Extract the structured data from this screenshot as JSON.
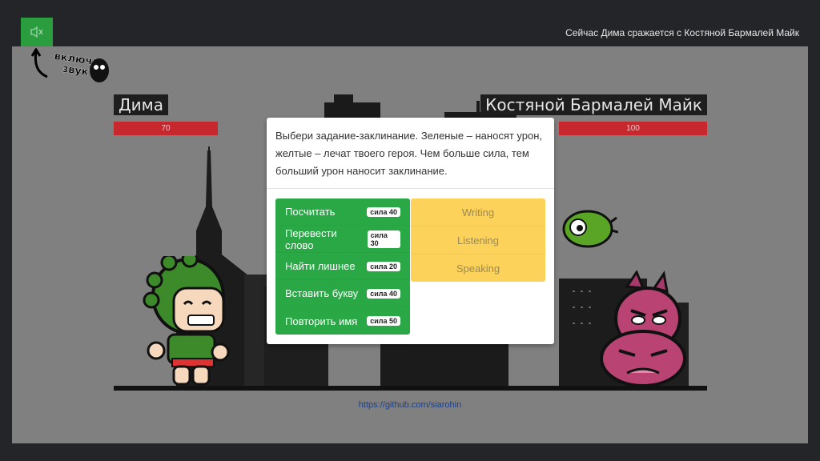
{
  "header": {
    "sound_icon": "speaker-muted-icon",
    "status": "Сейчас Дима сражается с Костяной Бармалей Майк"
  },
  "hint": {
    "label": "включи звук"
  },
  "hero": {
    "name": "Дима",
    "hp": "70",
    "hp_fraction": 1.0
  },
  "enemy": {
    "name": "Костяной Бармалей Майк",
    "hp": "100",
    "hp_fraction": 1.0
  },
  "modal": {
    "prompt": "Выбери задание-заклинание. Зеленые – наносят урон, желтые – лечат твоего героя. Чем больше сила, тем больший урон наносит заклинание.",
    "attack_spells": [
      {
        "label": "Посчитать",
        "power": "сила 40"
      },
      {
        "label": "Перевести слово",
        "power": "сила 30"
      },
      {
        "label": "Найти лишнее",
        "power": "сила 20"
      },
      {
        "label": "Вставить букву",
        "power": "сила 40"
      },
      {
        "label": "Повторить имя",
        "power": "сила 50"
      }
    ],
    "heal_spells": [
      {
        "label": "Writing"
      },
      {
        "label": "Listening"
      },
      {
        "label": "Speaking"
      }
    ]
  },
  "footer": {
    "link": "https://github.com/siarohin"
  },
  "colors": {
    "green": "#2aa846",
    "yellow": "#fdd25b",
    "hp_red": "#c6282e",
    "scene_bg": "#808080"
  }
}
